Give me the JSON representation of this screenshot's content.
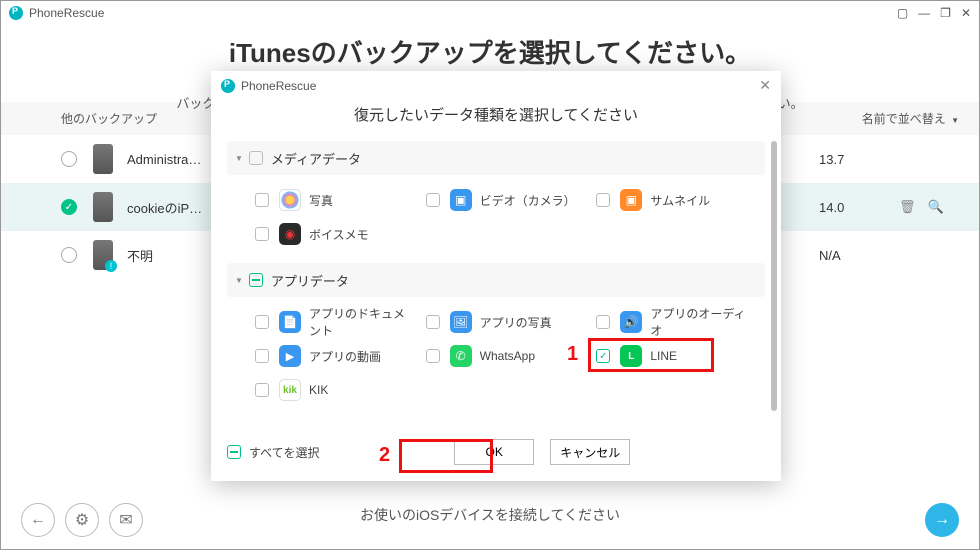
{
  "app": {
    "name": "PhoneRescue"
  },
  "window_controls": {
    "maximize": "▢",
    "minimize": "—",
    "restore": "❐",
    "close": "✕"
  },
  "main": {
    "title": "iTunesのバックアップを選択してください。",
    "subtitle_full": "バックアップのiOSバージョンがお使いのデバイスのiOSバージョンより新しくないことをご確認ください。"
  },
  "list_header": {
    "left": "他のバックアップ",
    "sort": "名前で並べ替え",
    "sort_chev": "▼"
  },
  "rows": [
    {
      "name": "Administra…",
      "version": "13.7",
      "selected": false,
      "warn": false
    },
    {
      "name": "cookieのiP…",
      "version": "14.0",
      "selected": true,
      "warn": false
    },
    {
      "name": "不明",
      "version": "N/A",
      "selected": false,
      "warn": true
    }
  ],
  "row_action_icons": {
    "trash": "🗑",
    "search": "🔍"
  },
  "footer_icons": {
    "back": "←",
    "gear": "⚙",
    "envelope": "✉",
    "next": "→"
  },
  "footer_text": "お使いのiOSデバイスを接続してください",
  "modal": {
    "title": "PhoneRescue",
    "close": "✕",
    "heading": "復元したいデータ種類を選択してください",
    "sections": [
      {
        "title": "メディアデータ",
        "state": "none",
        "items": [
          {
            "key": "photos",
            "label": "写真",
            "icon": "ic-photos",
            "checked": false
          },
          {
            "key": "video",
            "label": "ビデオ（カメラ）",
            "icon": "ic-video",
            "checked": false
          },
          {
            "key": "thumb",
            "label": "サムネイル",
            "icon": "ic-thumb",
            "checked": false
          },
          {
            "key": "memo",
            "label": "ボイスメモ",
            "icon": "ic-memo",
            "checked": false
          }
        ]
      },
      {
        "title": "アプリデータ",
        "state": "partial",
        "items": [
          {
            "key": "appdoc",
            "label": "アプリのドキュメント",
            "icon": "ic-doc",
            "checked": false
          },
          {
            "key": "appphoto",
            "label": "アプリの写真",
            "icon": "ic-apph",
            "checked": false
          },
          {
            "key": "appaudio",
            "label": "アプリのオーディオ",
            "icon": "ic-aud",
            "checked": false
          },
          {
            "key": "appvideo",
            "label": "アプリの動画",
            "icon": "ic-mv",
            "checked": false
          },
          {
            "key": "whatsapp",
            "label": "WhatsApp",
            "icon": "ic-wa",
            "checked": false
          },
          {
            "key": "line",
            "label": "LINE",
            "icon": "ic-line",
            "checked": true
          },
          {
            "key": "kik",
            "label": "KIK",
            "icon": "ic-kik",
            "checked": false
          }
        ]
      }
    ],
    "select_all": "すべてを選択",
    "ok": "OK",
    "cancel": "キャンセル",
    "annotations": {
      "one": "1",
      "two": "2"
    }
  }
}
